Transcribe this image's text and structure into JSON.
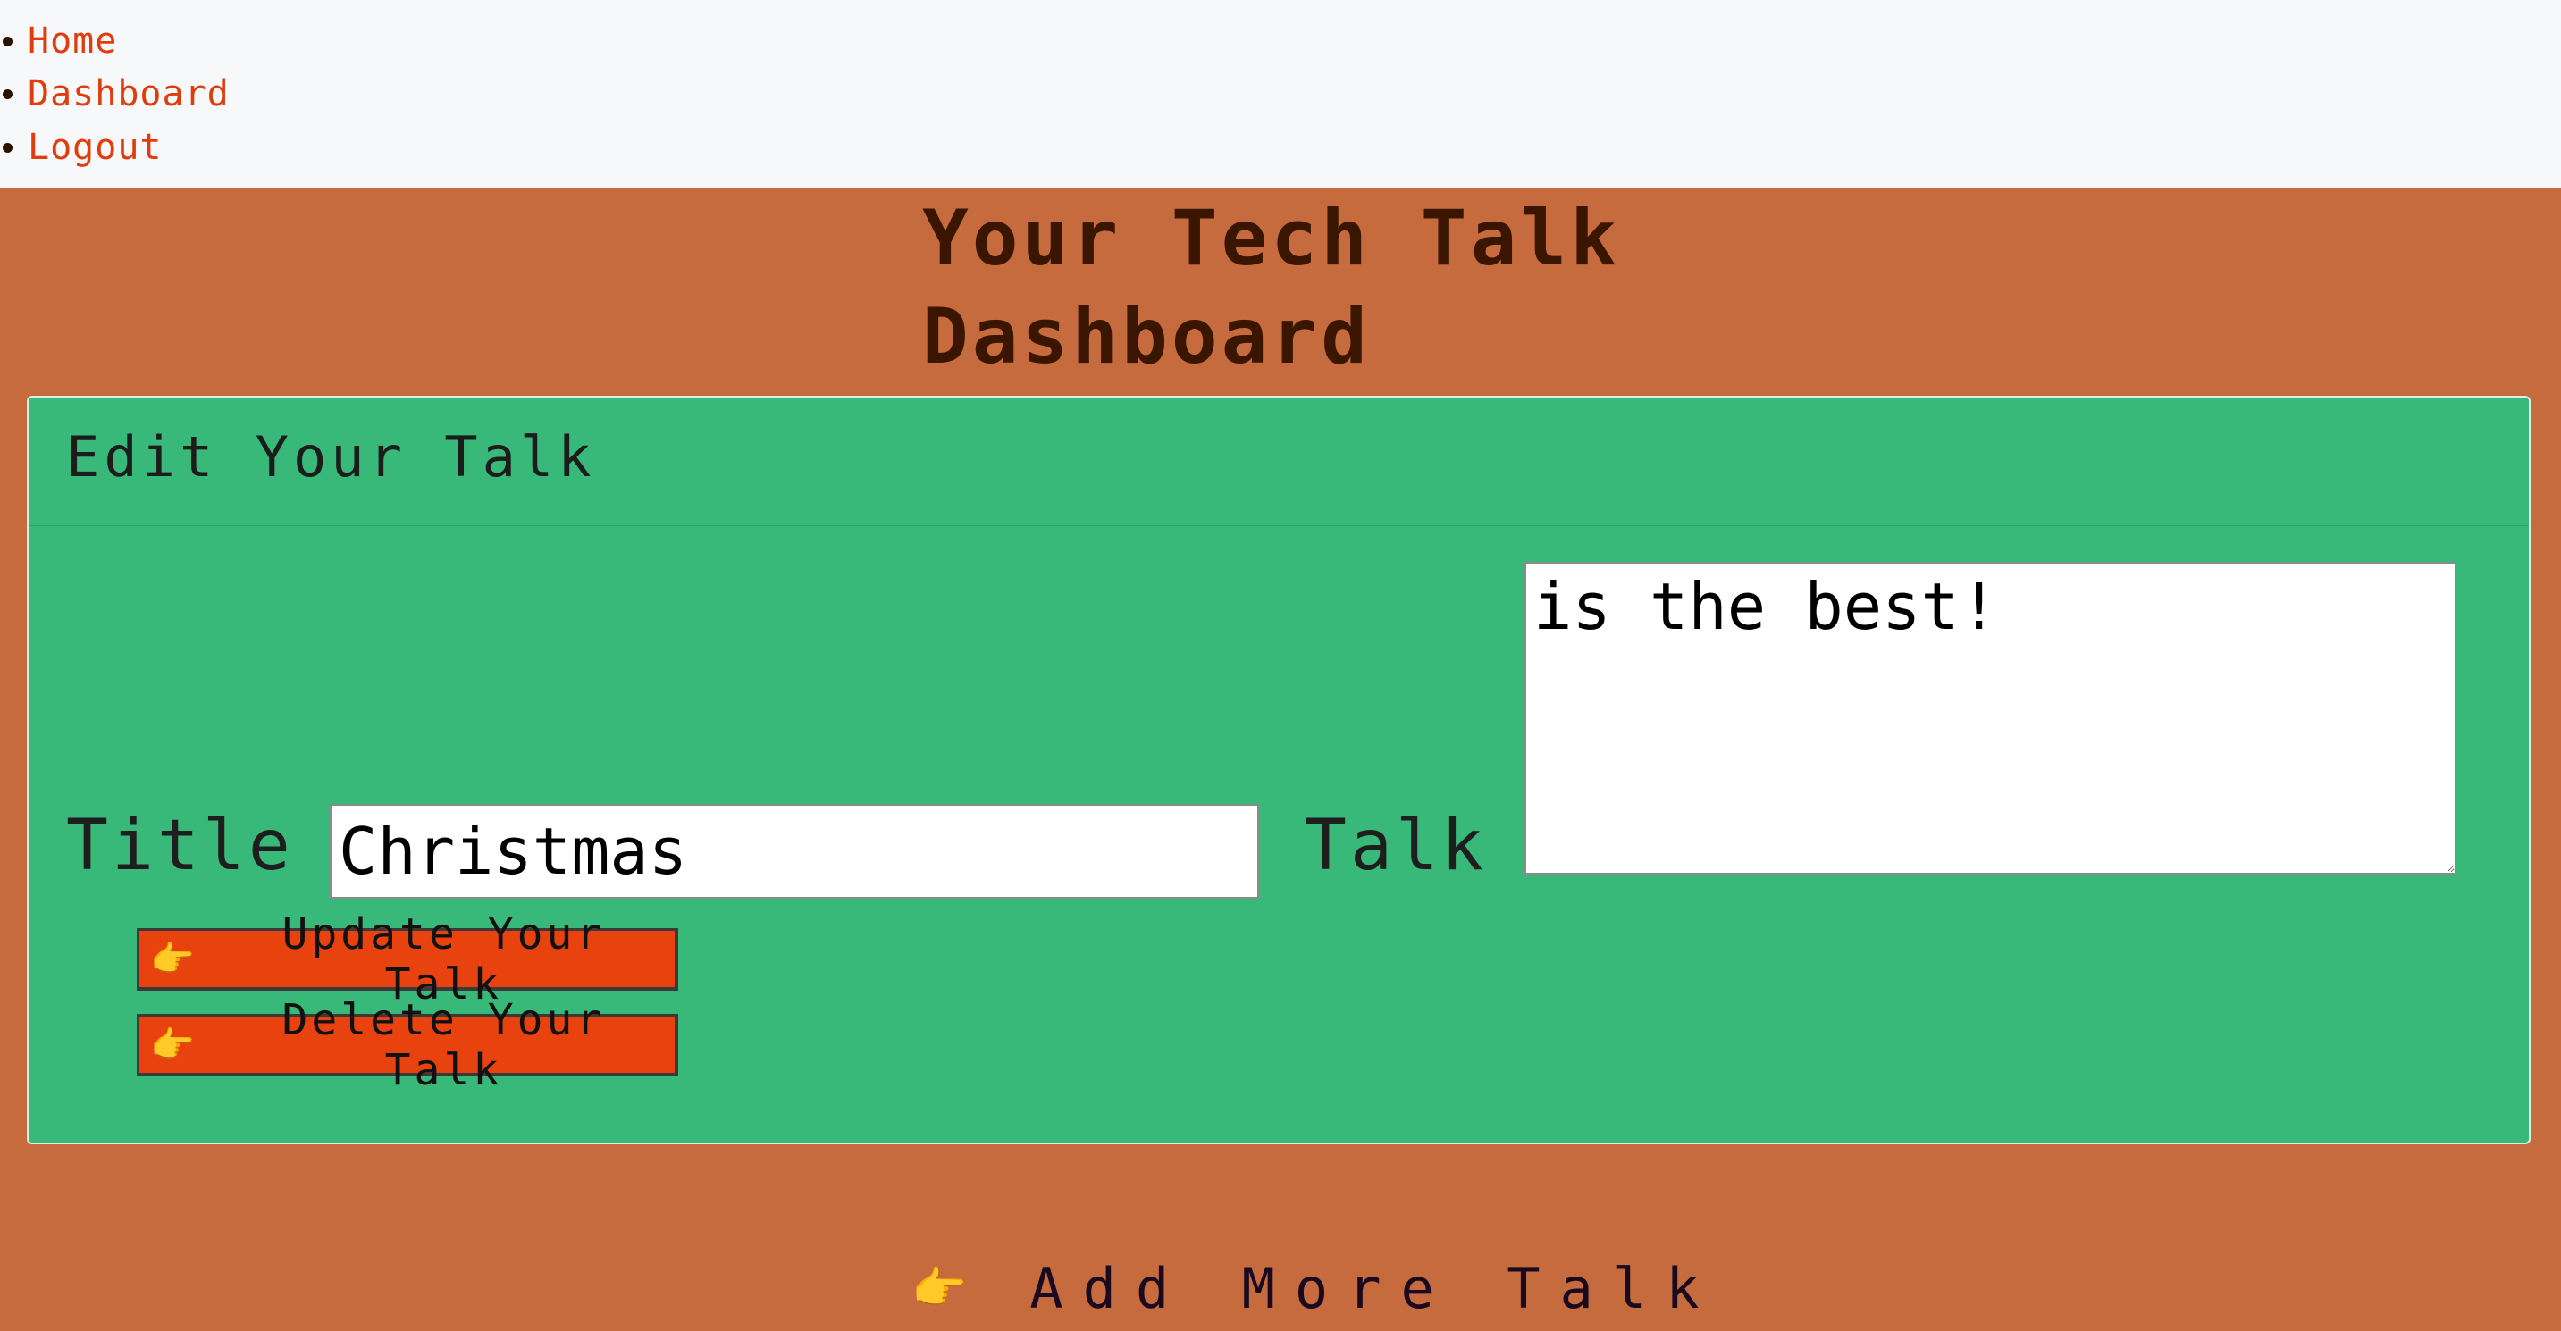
{
  "nav": {
    "items": [
      {
        "label": "Home"
      },
      {
        "label": "Dashboard"
      },
      {
        "label": "Logout"
      }
    ]
  },
  "page": {
    "title": "Your Tech Talk Dashboard"
  },
  "card": {
    "header": "Edit Your Talk",
    "title_label": "Title",
    "title_value": "Christmas",
    "talk_label": "Talk",
    "talk_value": "is the best!",
    "update_button": "Update Your Talk",
    "delete_button": "Delete Your Talk"
  },
  "add_more": {
    "label": "Add More Talk"
  },
  "icons": {
    "pointing_hand": "backhand-index-pointing-right-icon"
  },
  "colors": {
    "page_background": "#c66b3d",
    "nav_background": "#f7f8fa",
    "nav_link": "#e03c0c",
    "card_background": "#38b979",
    "button_background": "#e8420e",
    "title_text": "#3a1500"
  }
}
